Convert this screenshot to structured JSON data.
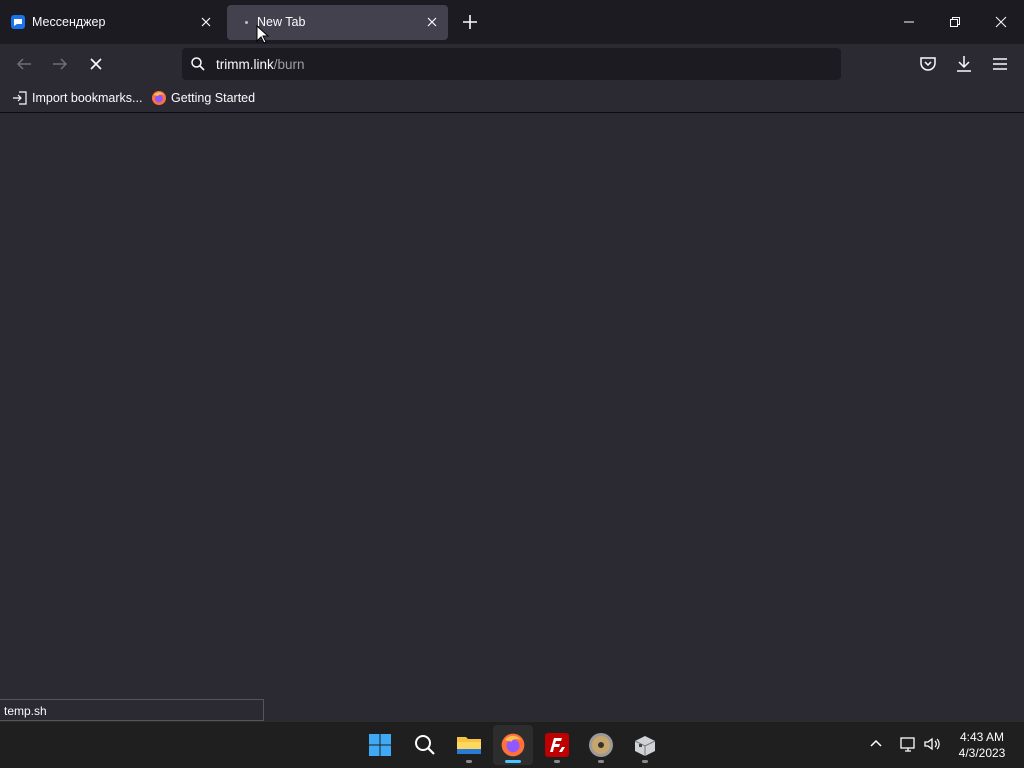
{
  "tabs": [
    {
      "title": "Мессенджер",
      "active": false
    },
    {
      "title": "New Tab",
      "active": true,
      "loading": true
    }
  ],
  "urlbar": {
    "domain": "trimm.link",
    "path": "/burn"
  },
  "bookmarks": [
    {
      "label": "Import bookmarks..."
    },
    {
      "label": "Getting Started"
    }
  ],
  "statusbar": {
    "text": "temp.sh"
  },
  "clock": {
    "time": "4:43 AM",
    "date": "4/3/2023"
  },
  "taskbar_apps": [
    "windows-start",
    "search",
    "file-explorer",
    "firefox",
    "filezilla",
    "disk-utility",
    "virtualbox"
  ],
  "colors": {
    "accent": "#4cc2ff",
    "toolbar": "#2b2a33",
    "tabstrip": "#1c1b22"
  }
}
